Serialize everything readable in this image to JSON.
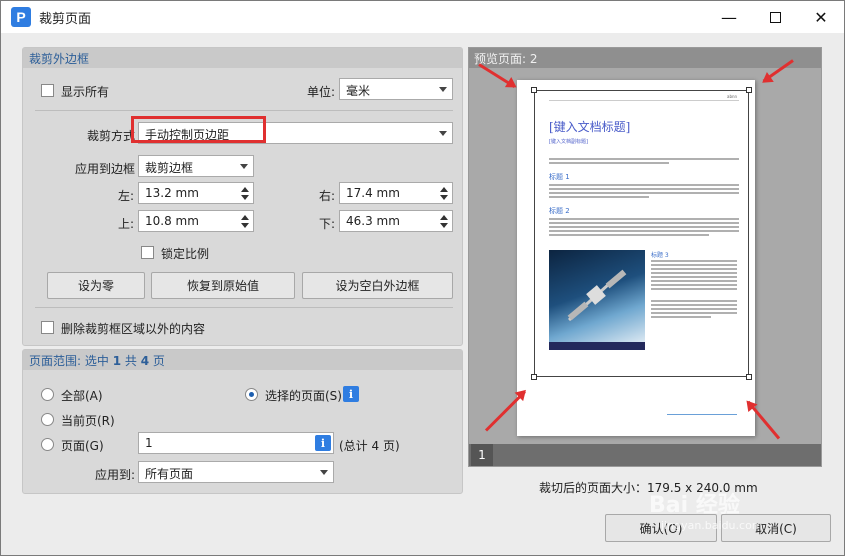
{
  "window": {
    "title": "裁剪页面",
    "app_icon_letter": "P"
  },
  "crop_box": {
    "heading": "裁剪外边框",
    "show_all_label": "显示所有",
    "unit_label": "单位:",
    "unit_value": "毫米",
    "crop_method_label": "裁剪方式",
    "crop_method_value": "手动控制页边距",
    "apply_to_label": "应用到边框",
    "apply_to_value": "裁剪边框",
    "left_label": "左:",
    "left_value": "13.2 mm",
    "right_label": "右:",
    "right_value": "17.4 mm",
    "top_label": "上:",
    "top_value": "10.8 mm",
    "bottom_label": "下:",
    "bottom_value": "46.3 mm",
    "lock_ratio_label": "锁定比例",
    "set_zero_label": "设为零",
    "restore_label": "恢复到原始值",
    "set_blank_label": "设为空白外边框",
    "delete_outside_label": "删除裁剪框区域以外的内容"
  },
  "page_range": {
    "heading_prefix": "页面范围: 选中",
    "selected_count": "1",
    "heading_mid": "共",
    "total_count": "4",
    "heading_suffix": "页",
    "all_label": "全部(A)",
    "selected_pages_label": "选择的页面(S)",
    "current_page_label": "当前页(R)",
    "pages_label": "页面(G)",
    "pages_value": "1",
    "total_label": "(总计 4 页)",
    "apply_label": "应用到:",
    "apply_value": "所有页面"
  },
  "preview": {
    "heading": "预览页面: 2",
    "page_number": "1",
    "doc_title": "[键入文档标题]",
    "doc_subtitle": "[键入文档副标题]",
    "heading1": "标题 1",
    "heading2": "标题 2",
    "heading3": "标题 3",
    "header_right": "abnn"
  },
  "cropped_size": "裁切后的页面大小：179.5 x 240.0 mm",
  "footer": {
    "ok_label": "确认(O)",
    "cancel_label": "取消(C)"
  },
  "watermark": {
    "text": "Bai 经验",
    "sub": "jingyan.baidu.com"
  },
  "colors": {
    "accent": "#2f7de1",
    "annotation_red": "#e03030",
    "panel_heading": "#2d5f99"
  }
}
